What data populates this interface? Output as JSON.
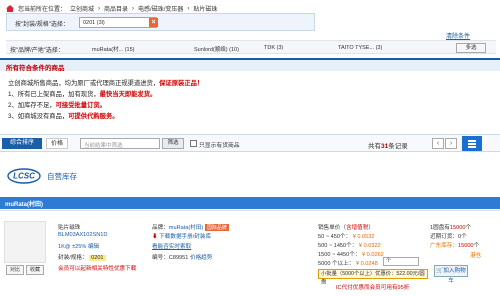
{
  "breadcrumb": {
    "prefix": "您当前所在位置：",
    "items": [
      "立创商城",
      "商品目录",
      "电感/磁珠/变压器",
      "贴片磁珠"
    ]
  },
  "filter": {
    "label": "按\"封装/规格\"选择：",
    "value": "0201 (3l)",
    "clear_link": "清除条件"
  },
  "brand_row": {
    "label": "按\"品牌/产地\"选择：",
    "brands": [
      "muRata(村...   (15)",
      "Sunlord(顺络) (10)",
      "TDK (3)",
      "TAITO TYSE... (3)"
    ],
    "multi_label": "多选"
  },
  "section_title": "所有符合条件的商品",
  "notice": {
    "line1_prefix": "立创商城所售商品，均为原厂或代理商正规渠道进货，",
    "line1_red": "保证原装正品！",
    "line2_prefix": "1、所有已上架商品，加有现货，",
    "line2_red": "最快当天即能发货。",
    "line3_prefix": "2、加库存不足，",
    "line3_red": "可接受批量订货。",
    "line4_prefix": "3、如商城没有商品，",
    "line4_red": "可提供代购服务。"
  },
  "toolbar": {
    "sort_label": "综合排序",
    "price_label": "价格",
    "search_placeholder": "当前结果中筛选",
    "filter_btn": "筛选",
    "stock_only": "只显示有货商品",
    "count_prefix": "共有",
    "count": "31",
    "count_suffix": "条记录",
    "prev": "‹",
    "next": "›"
  },
  "supplier": {
    "logo_text": "LCSC",
    "name": "自营库存"
  },
  "brand_bar": "muRata(村田)",
  "product": {
    "category": "贴片磁珠",
    "part_no": "BLM03AX102SN1D",
    "rating": "1K@",
    "rating_pct": "±25%",
    "compare": "编辑",
    "package_label": "封装/规格：",
    "package_value": "0201",
    "brand_label": "品牌：",
    "brand_value": "muRata(村田)",
    "brand_badge": "国际品牌",
    "datasheet": "下载数据手册/封装库",
    "custom": "看能否实时索取",
    "code_label": "编号：",
    "code_value": "C89951",
    "price_trend": "价格趋势",
    "tag1": "对比",
    "tag2": "收藏",
    "self_note": "会员可以起新相关特性优惠下载",
    "price_title": "销售单价（",
    "price_title_red": "含增值税",
    "price_title_end": "）",
    "tiers": [
      {
        "range": "50 ~ 450个：",
        "price": "¥ 0.0532"
      },
      {
        "range": "500 ~ 1450个：",
        "price": "¥ 0.0322"
      },
      {
        "range": "1500 ~ 4450个：",
        "price": "¥ 0.0262"
      },
      {
        "range": "5000 个以上：",
        "price": "¥ 0.0248"
      }
    ],
    "stock_title": "1圆盘有",
    "stock_n": "15000",
    "stock_unit": "个",
    "stock_near": "近期订货：",
    "stock_near_n": "0个",
    "stock_jp": "广东库存：",
    "stock_jp_n": "15000",
    "stock_jp_unit": "个",
    "stock_sz": "港仓",
    "qty_value": "个",
    "lot_label": "小批量（5000个以上）优惠价：522.00元/圆盘",
    "add_cart": "加入购物车",
    "promo": "IC代付优惠而会员可用有95折"
  }
}
